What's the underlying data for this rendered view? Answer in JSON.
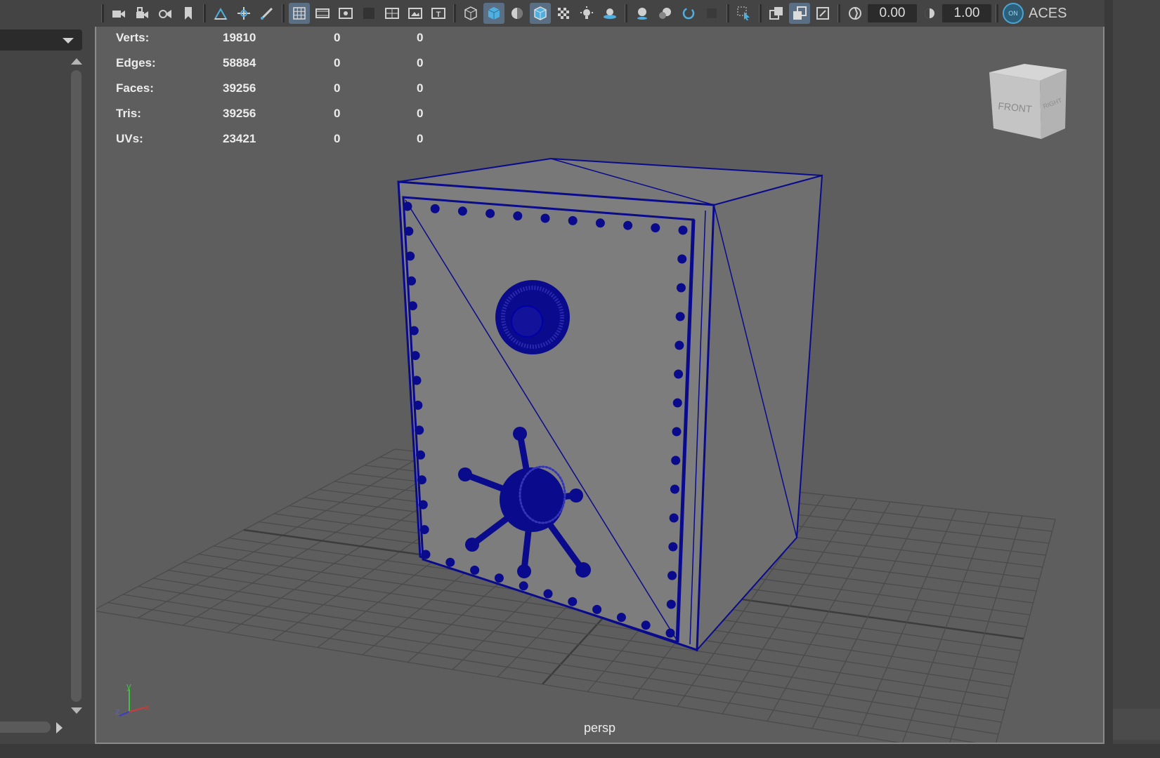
{
  "hud": {
    "rows": [
      {
        "label": "Verts:",
        "v1": "19810",
        "v2": "0",
        "v3": "0"
      },
      {
        "label": "Edges:",
        "v1": "58884",
        "v2": "0",
        "v3": "0"
      },
      {
        "label": "Faces:",
        "v1": "39256",
        "v2": "0",
        "v3": "0"
      },
      {
        "label": "Tris:",
        "v1": "39256",
        "v2": "0",
        "v3": "0"
      },
      {
        "label": "UVs:",
        "v1": "23421",
        "v2": "0",
        "v3": "0"
      }
    ]
  },
  "toolbar": {
    "exposure": "0.00",
    "gamma": "1.00",
    "color_space": "ACES",
    "color_mgmt_on": "ON"
  },
  "view_cube": {
    "front": "FRONT",
    "right": "RIGHT"
  },
  "axis": {
    "y": "y",
    "z": "z",
    "x": "x"
  },
  "viewport": {
    "camera": "persp"
  },
  "colors": {
    "wireframe": "#0a0a8c",
    "viewport_bg": "#5e5e5e",
    "active_button": "#5b6f84"
  }
}
